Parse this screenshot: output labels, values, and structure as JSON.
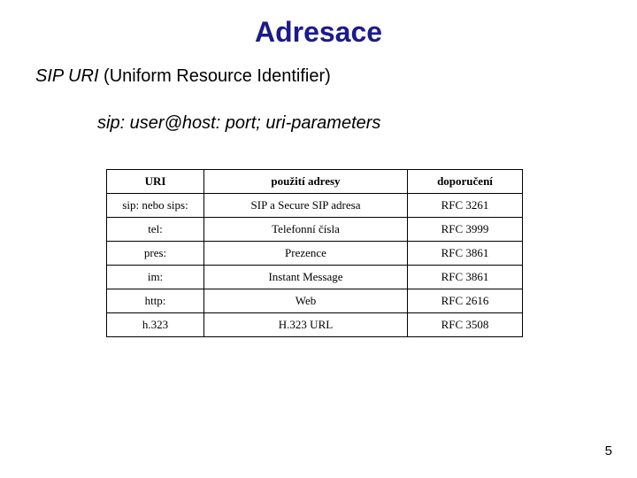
{
  "title": "Adresace",
  "subtitle_ital": "SIP URI",
  "subtitle_rest": " (Uniform Resource Identifier)",
  "syntax": "sip: user@host: port; uri-parameters",
  "table": {
    "headers": [
      "URI",
      "použití adresy",
      "doporučení"
    ],
    "rows": [
      [
        "sip: nebo sips:",
        "SIP a Secure SIP adresa",
        "RFC 3261"
      ],
      [
        "tel:",
        "Telefonní čísla",
        "RFC 3999"
      ],
      [
        "pres:",
        "Prezence",
        "RFC 3861"
      ],
      [
        "im:",
        "Instant Message",
        "RFC 3861"
      ],
      [
        "http:",
        "Web",
        "RFC 2616"
      ],
      [
        "h.323",
        "H.323 URL",
        "RFC 3508"
      ]
    ]
  },
  "page_number": "5"
}
